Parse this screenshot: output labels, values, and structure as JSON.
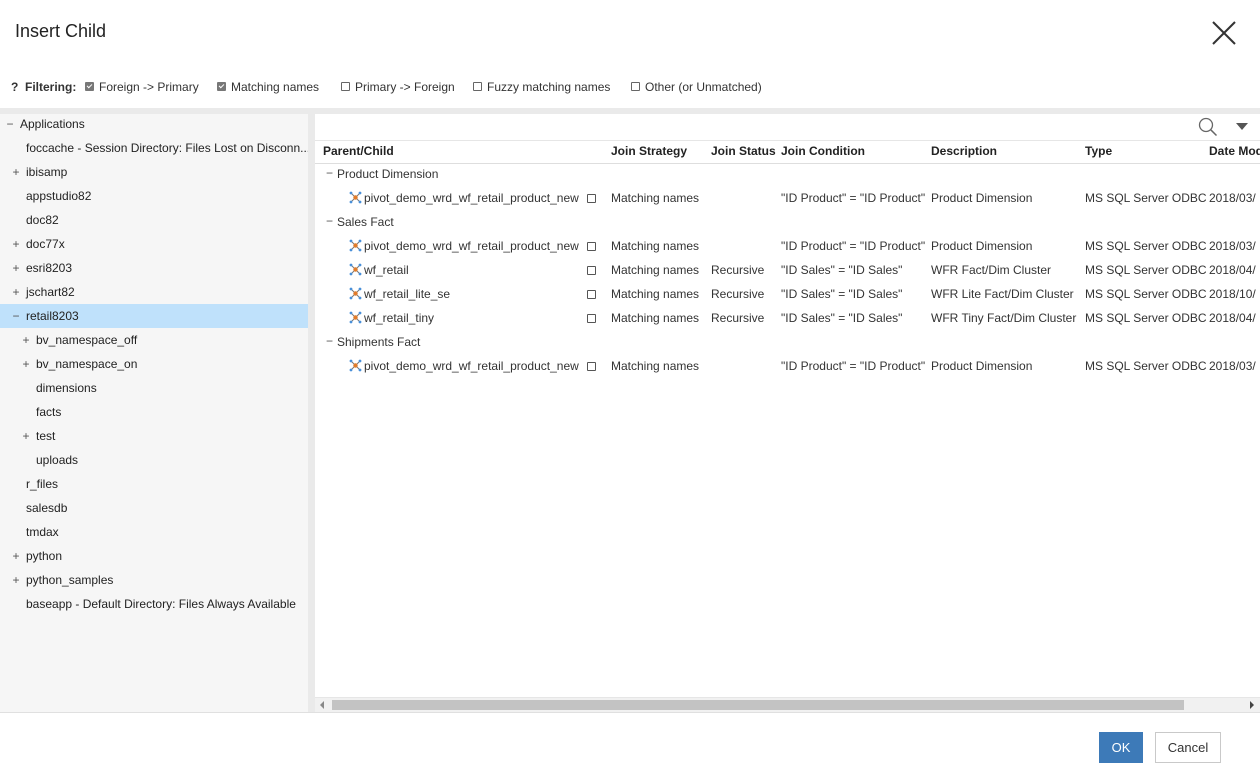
{
  "dialog": {
    "title": "Insert Child"
  },
  "filtering": {
    "help": "?",
    "label": "Filtering:",
    "options": [
      {
        "label": "Foreign -> Primary",
        "checked": true
      },
      {
        "label": "Matching names",
        "checked": true
      },
      {
        "label": "Primary -> Foreign",
        "checked": false
      },
      {
        "label": "Fuzzy matching names",
        "checked": false
      },
      {
        "label": "Other (or Unmatched)",
        "checked": false
      }
    ]
  },
  "tree": {
    "nodes": [
      {
        "label": "Applications",
        "expander": "−",
        "level": 0,
        "selected": false
      },
      {
        "label": "foccache - Session Directory: Files Lost on Disconn...",
        "expander": "",
        "level": 1,
        "selected": false
      },
      {
        "label": "ibisamp",
        "expander": "+",
        "level": 1,
        "selected": false
      },
      {
        "label": "appstudio82",
        "expander": "",
        "level": 1,
        "selected": false
      },
      {
        "label": "doc82",
        "expander": "",
        "level": 1,
        "selected": false
      },
      {
        "label": "doc77x",
        "expander": "+",
        "level": 1,
        "selected": false
      },
      {
        "label": "esri8203",
        "expander": "+",
        "level": 1,
        "selected": false
      },
      {
        "label": "jschart82",
        "expander": "+",
        "level": 1,
        "selected": false
      },
      {
        "label": "retail8203",
        "expander": "−",
        "level": 1,
        "selected": true
      },
      {
        "label": "bv_namespace_off",
        "expander": "+",
        "level": 2,
        "selected": false
      },
      {
        "label": "bv_namespace_on",
        "expander": "+",
        "level": 2,
        "selected": false
      },
      {
        "label": "dimensions",
        "expander": "",
        "level": 2,
        "selected": false
      },
      {
        "label": "facts",
        "expander": "",
        "level": 2,
        "selected": false
      },
      {
        "label": "test",
        "expander": "+",
        "level": 2,
        "selected": false
      },
      {
        "label": "uploads",
        "expander": "",
        "level": 2,
        "selected": false
      },
      {
        "label": "r_files",
        "expander": "",
        "level": 1,
        "selected": false
      },
      {
        "label": "salesdb",
        "expander": "",
        "level": 1,
        "selected": false
      },
      {
        "label": "tmdax",
        "expander": "",
        "level": 1,
        "selected": false
      },
      {
        "label": "python",
        "expander": "+",
        "level": 1,
        "selected": false
      },
      {
        "label": "python_samples",
        "expander": "+",
        "level": 1,
        "selected": false
      },
      {
        "label": "baseapp - Default Directory: Files Always Available",
        "expander": "",
        "level": 1,
        "selected": false
      }
    ]
  },
  "grid": {
    "toolbar": {
      "search_icon": "search-icon",
      "menu_icon": "chevron-down-icon"
    },
    "columns": [
      "Parent/Child",
      "Join Strategy",
      "Join Status",
      "Join Condition",
      "Description",
      "Type",
      "Date Mod"
    ],
    "rows": [
      {
        "kind": "group",
        "expander": "−",
        "name": "Product Dimension"
      },
      {
        "kind": "item",
        "name": "pivot_demo_wrd_wf_retail_product_new",
        "strategy": "Matching names",
        "status": "",
        "condition": "\"ID Product\" = \"ID Product\"",
        "description": "Product Dimension",
        "type": "MS SQL Server ODBC",
        "date": "2018/03/"
      },
      {
        "kind": "group",
        "expander": "−",
        "name": "Sales Fact"
      },
      {
        "kind": "item",
        "name": "pivot_demo_wrd_wf_retail_product_new",
        "strategy": "Matching names",
        "status": "",
        "condition": "\"ID Product\" = \"ID Product\"",
        "description": "Product Dimension",
        "type": "MS SQL Server ODBC",
        "date": "2018/03/"
      },
      {
        "kind": "item",
        "name": "wf_retail",
        "strategy": "Matching names",
        "status": "Recursive",
        "condition": "\"ID Sales\" = \"ID Sales\"",
        "description": "WFR Fact/Dim Cluster",
        "type": "MS SQL Server ODBC",
        "date": "2018/04/"
      },
      {
        "kind": "item",
        "name": "wf_retail_lite_se",
        "strategy": "Matching names",
        "status": "Recursive",
        "condition": "\"ID Sales\" = \"ID Sales\"",
        "description": "WFR Lite Fact/Dim Cluster",
        "type": "MS SQL Server ODBC",
        "date": "2018/10/"
      },
      {
        "kind": "item",
        "name": "wf_retail_tiny",
        "strategy": "Matching names",
        "status": "Recursive",
        "condition": "\"ID Sales\" = \"ID Sales\"",
        "description": "WFR Tiny Fact/Dim Cluster",
        "type": "MS SQL Server ODBC",
        "date": "2018/04/"
      },
      {
        "kind": "group",
        "expander": "−",
        "name": "Shipments Fact"
      },
      {
        "kind": "item",
        "name": "pivot_demo_wrd_wf_retail_product_new",
        "strategy": "Matching names",
        "status": "",
        "condition": "\"ID Product\" = \"ID Product\"",
        "description": "Product Dimension",
        "type": "MS SQL Server ODBC",
        "date": "2018/03/"
      }
    ],
    "horizontal_scroll": 0.0
  },
  "footer": {
    "ok_label": "OK",
    "cancel_label": "Cancel"
  },
  "colors": {
    "accent": "#3d7ab8",
    "selection": "#bfe1fb"
  }
}
